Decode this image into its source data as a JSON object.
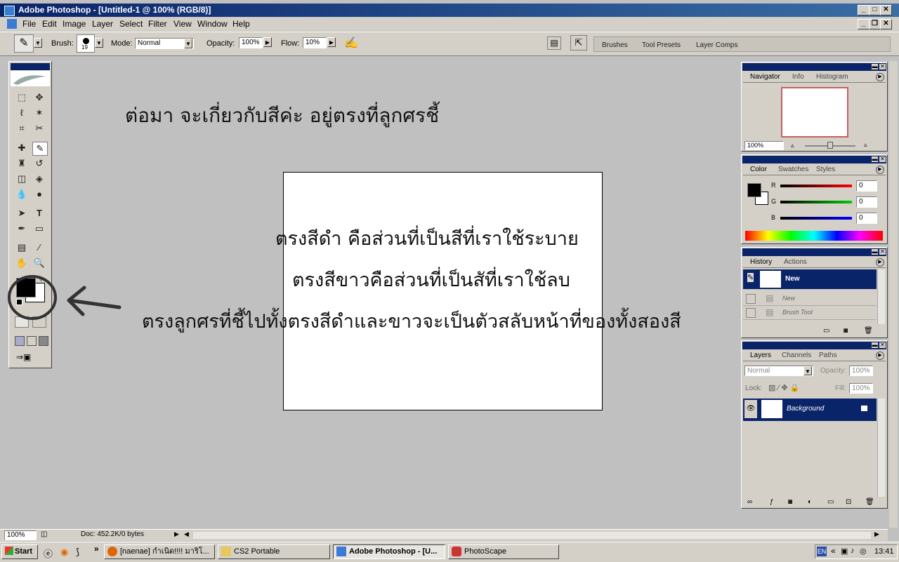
{
  "window": {
    "title": "Adobe Photoshop - [Untitled-1 @ 100% (RGB/8)]"
  },
  "menu": [
    "File",
    "Edit",
    "Image",
    "Layer",
    "Select",
    "Filter",
    "View",
    "Window",
    "Help"
  ],
  "options": {
    "brush_label": "Brush:",
    "brush_size": "19",
    "mode_label": "Mode:",
    "mode_value": "Normal",
    "opacity_label": "Opacity:",
    "opacity_value": "100%",
    "flow_label": "Flow:",
    "flow_value": "10%",
    "well_tabs": [
      "Brushes",
      "Tool Presets",
      "Layer Comps"
    ]
  },
  "annotations": {
    "heading": "ต่อมา จะเกี่ยวกับสีค่ะ อยู่ตรงที่ลูกศรชี้",
    "line1": "ตรงสีดำ คือส่วนที่เป็นสีที่เราใช้ระบาย",
    "line2": "ตรงสีขาวคือส่วนที่เป็นสัที่เราใช้ลบ",
    "line3": "ตรงลูกศรที่ชี้ไปทั้งตรงสีดำและขาวจะเป็นตัวสลับหน้าที่ของทั้งสองสี"
  },
  "navigator": {
    "tabs": [
      "Navigator",
      "Info",
      "Histogram"
    ],
    "zoom": "100%"
  },
  "color": {
    "tabs": [
      "Color",
      "Swatches",
      "Styles"
    ],
    "r_label": "R",
    "g_label": "G",
    "b_label": "B",
    "r": "0",
    "g": "0",
    "b": "0"
  },
  "history": {
    "tabs": [
      "History",
      "Actions"
    ],
    "snapshot": "New",
    "items": [
      "New",
      "Brush Tool"
    ]
  },
  "layers": {
    "tabs": [
      "Layers",
      "Channels",
      "Paths"
    ],
    "blend": "Normal",
    "opacity_label": "Opacity:",
    "opacity": "100%",
    "lock_label": "Lock:",
    "fill_label": "Fill:",
    "fill": "100%",
    "layer_name": "Background"
  },
  "status": {
    "zoom": "100%",
    "doc": "Doc: 452.2K/0 bytes"
  },
  "taskbar": {
    "start": "Start",
    "tasks": [
      "[naenae] กำเนิด!!!! มาริโ...",
      "CS2 Portable",
      "Adobe Photoshop - [U...",
      "PhotoScape"
    ],
    "lang": "EN",
    "clock": "13:41"
  },
  "colors": {
    "titlebar": "#0a246a",
    "selection": "#0a246a",
    "canvas_bg": "#c0c0c0",
    "chrome": "#d4d0c8"
  }
}
